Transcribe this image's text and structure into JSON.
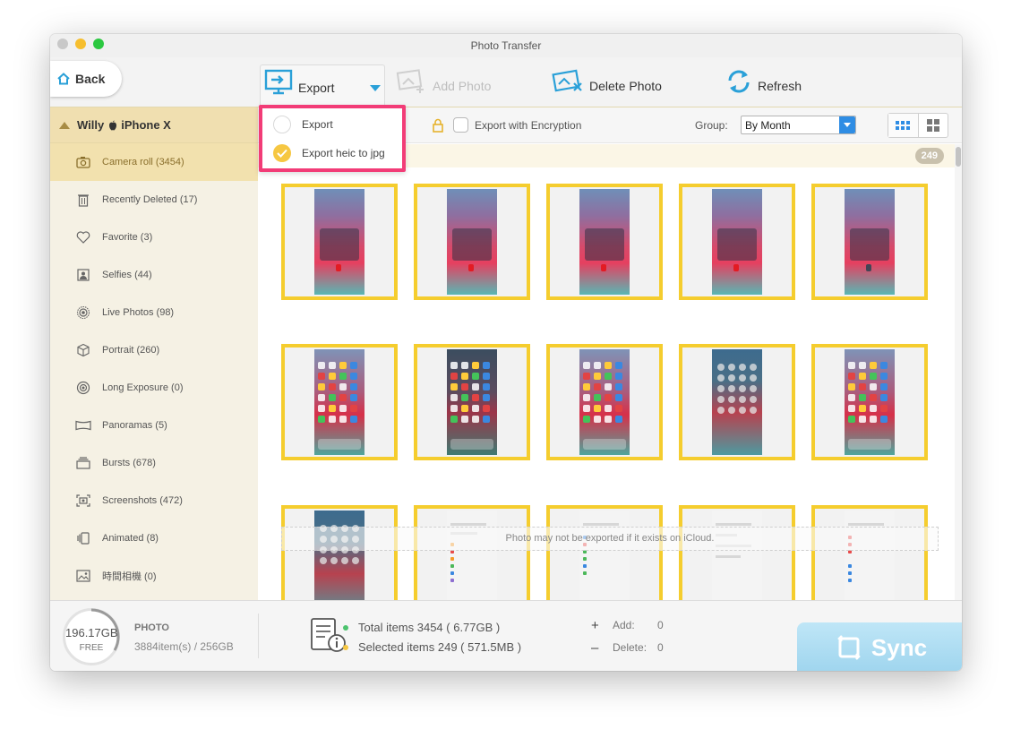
{
  "window": {
    "title": "Photo Transfer"
  },
  "toolbar": {
    "back_label": "Back",
    "export_label": "Export",
    "add_photo_label": "Add Photo",
    "delete_photo_label": "Delete Photo",
    "refresh_label": "Refresh"
  },
  "export_menu": {
    "items": [
      {
        "label": "Export",
        "checked": false
      },
      {
        "label": "Export heic to jpg",
        "checked": true
      }
    ]
  },
  "sidebar": {
    "device_name": "Willy",
    "device_model": "iPhone X",
    "items": [
      {
        "label": "Camera roll (3454)",
        "icon": "camera-icon",
        "active": true
      },
      {
        "label": "Recently Deleted (17)",
        "icon": "trash-icon",
        "active": false
      },
      {
        "label": "Favorite (3)",
        "icon": "heart-icon",
        "active": false
      },
      {
        "label": "Selfies (44)",
        "icon": "person-icon",
        "active": false
      },
      {
        "label": "Live Photos (98)",
        "icon": "live-icon",
        "active": false
      },
      {
        "label": "Portrait (260)",
        "icon": "cube-icon",
        "active": false
      },
      {
        "label": "Long Exposure (0)",
        "icon": "exposure-icon",
        "active": false
      },
      {
        "label": "Panoramas (5)",
        "icon": "panorama-icon",
        "active": false
      },
      {
        "label": "Bursts (678)",
        "icon": "bursts-icon",
        "active": false
      },
      {
        "label": "Screenshots (472)",
        "icon": "screenshot-icon",
        "active": false
      },
      {
        "label": "Animated (8)",
        "icon": "animated-icon",
        "active": false
      },
      {
        "label": "時間相機 (0)",
        "icon": "image-icon",
        "active": false
      }
    ]
  },
  "subbar": {
    "encryption_label": "Export with Encryption",
    "group_label": "Group:",
    "group_value": "By Month"
  },
  "gallery": {
    "count_badge": "249",
    "icloud_note": "Photo may not be exported if it exists on iCloud."
  },
  "footer": {
    "storage_free": "196.17GB",
    "storage_free_label": "FREE",
    "category_title": "PHOTO",
    "category_detail": "3884item(s) / 256GB",
    "total_items": "Total items 3454 ( 6.77GB )",
    "selected_items": "Selected items 249 ( 571.5MB )",
    "add_label": "Add:",
    "add_value": "0",
    "delete_label": "Delete:",
    "delete_value": "0",
    "sync_label": "Sync"
  },
  "colors": {
    "accent": "#2aa0d8",
    "selection_border": "#f5cd2e",
    "highlight_box": "#f23c77",
    "sidebar_active": "#f2e1ae"
  }
}
